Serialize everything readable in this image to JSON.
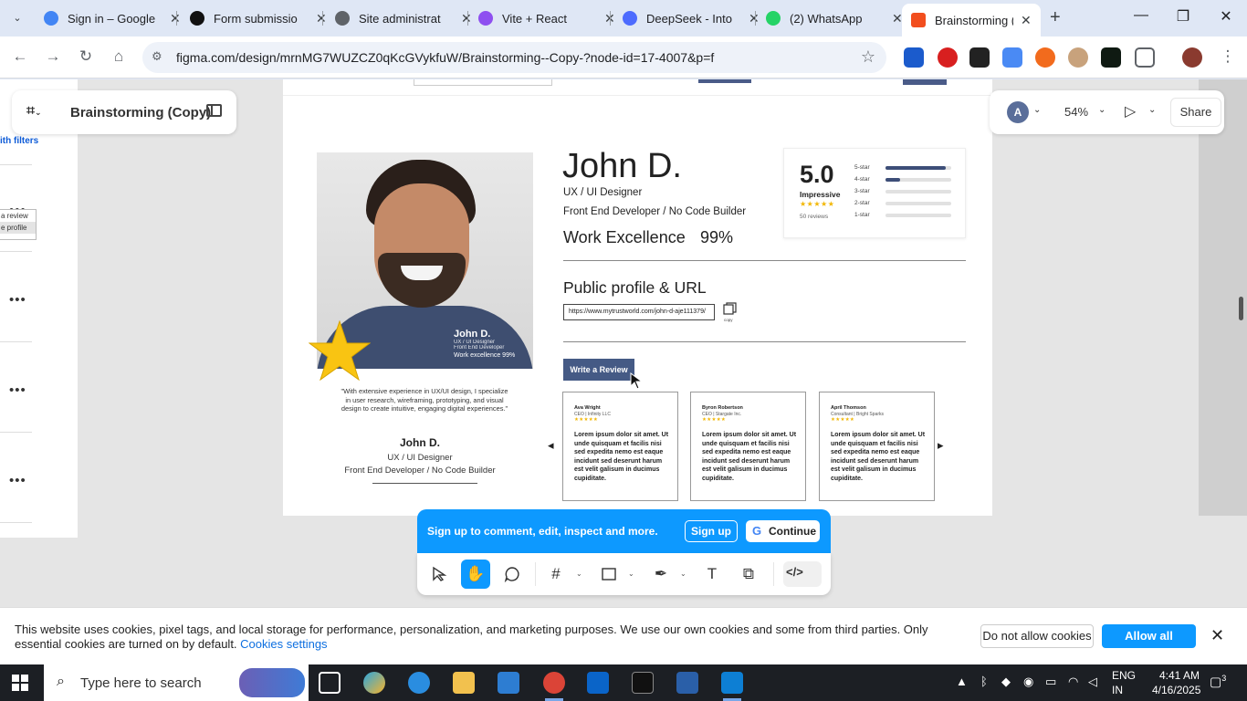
{
  "browser": {
    "tabs": [
      {
        "label": "Sign in – Google",
        "color": "#4285f4"
      },
      {
        "label": "Form submissio",
        "color": "#111111"
      },
      {
        "label": "Site administrat",
        "color": "#5f6368"
      },
      {
        "label": "Vite + React",
        "color": "#8e4ff0"
      },
      {
        "label": "DeepSeek - Into",
        "color": "#4d6bfe"
      },
      {
        "label": "(2) WhatsApp",
        "color": "#25d366"
      },
      {
        "label": "Brainstorming (C",
        "color": "#f24e1e"
      }
    ],
    "url": "figma.com/design/mrnMG7WUZCZ0qKcGVykfuW/Brainstorming--Copy-?node-id=17-4007&p=f"
  },
  "figma": {
    "file_title": "Brainstorming (Copy)",
    "avatar_letter": "A",
    "zoom": "54%",
    "share_label": "Share",
    "left_panel": {
      "filter_text": "ith filters",
      "menu_items": [
        "a review",
        "e profile"
      ]
    }
  },
  "profile": {
    "name": "John D.",
    "role": "UX / UI Designer",
    "subtitle": "Front End Developer / No Code Builder",
    "work_label": "Work Excellence",
    "work_value": "99%",
    "photo_caption": {
      "name": "John D.",
      "role": "UX / UI Designer",
      "sub": "Front End Developer",
      "work": "Work excellence  99%"
    },
    "quote": "\"With extensive experience in UX/UI design, I specialize in user research, wireframing, prototyping, and visual design to create intuitive, engaging digital experiences.\"",
    "card_name": "John D.",
    "card_role": "UX / UI Designer",
    "card_sub": "Front End Developer / No Code Builder"
  },
  "rating": {
    "score": "5.0",
    "label": "Impressive",
    "stars": "★★★★★",
    "count": "50 reviews",
    "rows": [
      {
        "label": "5-star",
        "fill": 0.92
      },
      {
        "label": "4-star",
        "fill": 0.22
      },
      {
        "label": "3-star",
        "fill": 0
      },
      {
        "label": "2-star",
        "fill": 0
      },
      {
        "label": "1-star",
        "fill": 0
      }
    ]
  },
  "public_profile": {
    "title": "Public profile & URL",
    "url": "https://www.mytrustworld.com/john-d-aje111379/",
    "copy_label": "copy",
    "write_review": "Write a Review"
  },
  "reviews": [
    {
      "name": "Ava Wright",
      "role": "CEO | Infinity LLC",
      "stars": "★★★★★",
      "text": "Lorem ipsum dolor sit amet. Ut unde quisquam et facilis nisi sed expedita nemo est eaque incidunt sed deserunt harum est velit galisum in ducimus cupiditate."
    },
    {
      "name": "Byron Robertson",
      "role": "CEO | Stargate Inc.",
      "stars": "★★★★★",
      "text": "Lorem ipsum dolor sit amet. Ut unde quisquam et facilis nisi sed expedita nemo est eaque incidunt sed deserunt harum est velit galisum in ducimus cupiditate."
    },
    {
      "name": "April Thomson",
      "role": "Consultant | Bright Sparks",
      "stars": "★★★★★",
      "text": "Lorem ipsum dolor sit amet. Ut unde quisquam et facilis nisi sed expedita nemo est eaque incidunt sed deserunt harum est velit galisum in ducimus cupiditate."
    }
  ],
  "signup_bar": {
    "text": "Sign up to comment, edit, inspect and more.",
    "signup_label": "Sign up",
    "continue_label": "Continue"
  },
  "cookie": {
    "text": "This website uses cookies, pixel tags, and local storage for performance, personalization, and marketing purposes. We use our own cookies and some from third parties. Only essential cookies are turned on by default.",
    "settings_link": "Cookies settings",
    "deny_label": "Do not allow cookies",
    "allow_label": "Allow all cookies"
  },
  "taskbar": {
    "search_placeholder": "Type here to search",
    "lang_top": "ENG",
    "lang_bottom": "IN",
    "time": "4:41 AM",
    "date": "4/16/2025",
    "notification_count": "3"
  },
  "colors": {
    "figma_blue": "#0d99ff",
    "brand_navy": "#455a85",
    "star_yellow": "#f2b705"
  }
}
